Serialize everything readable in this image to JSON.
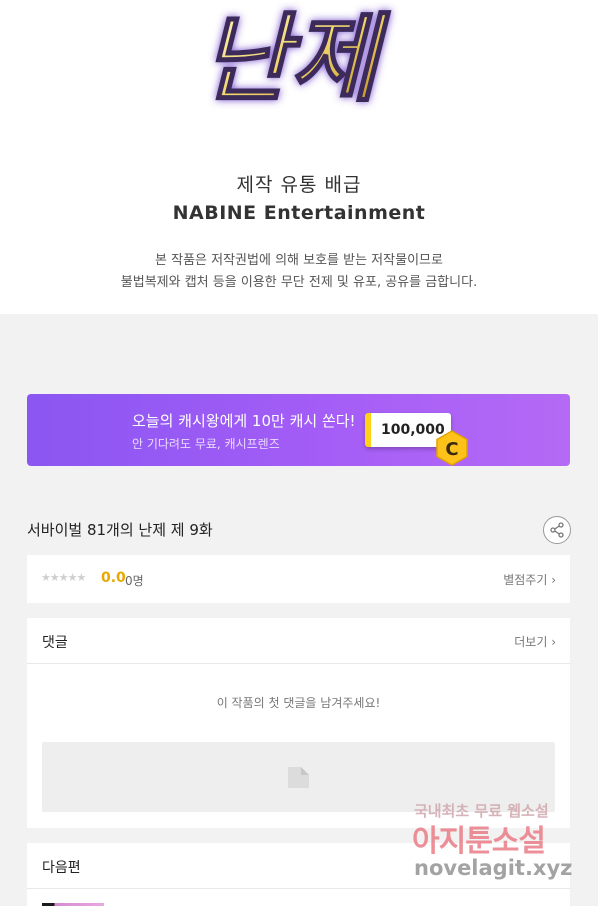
{
  "header": {
    "logo_text": "난제"
  },
  "credits": {
    "label": "제작 유통 배급",
    "company": "NABINE Entertainment",
    "copyright_line1": "본 작품은 저작권법에 의해 보호를 받는 저작물이므로",
    "copyright_line2": "불법복제와 캡처 등을 이용한 무단 전제 및 유포, 공유를 금합니다."
  },
  "banner": {
    "title": "오늘의 캐시왕에게 10만 캐시 쏜다!",
    "subtitle": "안 기다려도 무료, 캐시프렌즈",
    "amount": "100,000",
    "coin_letter": "C",
    "colors": {
      "start": "#8b56f2",
      "end": "#b56af5",
      "coin": "#ffc21a"
    }
  },
  "episode": {
    "title": "서바이벌 81개의 난제 제 9화",
    "share_icon": "share-icon"
  },
  "rating": {
    "stars": "★★★★★",
    "score": "0.0",
    "count": "0명",
    "rate_link": "별점주기 ›"
  },
  "comments": {
    "label": "댓글",
    "more_link": "더보기 ›",
    "empty_message": "이 작품의 첫 댓글을 남겨주세요!",
    "input_icon": "comment-edit-icon"
  },
  "next": {
    "label": "다음편"
  },
  "watermark": {
    "line1": "국내최초 무료 웹소설",
    "line2": "아지툰소설",
    "line3": "novelagit.xyz"
  }
}
